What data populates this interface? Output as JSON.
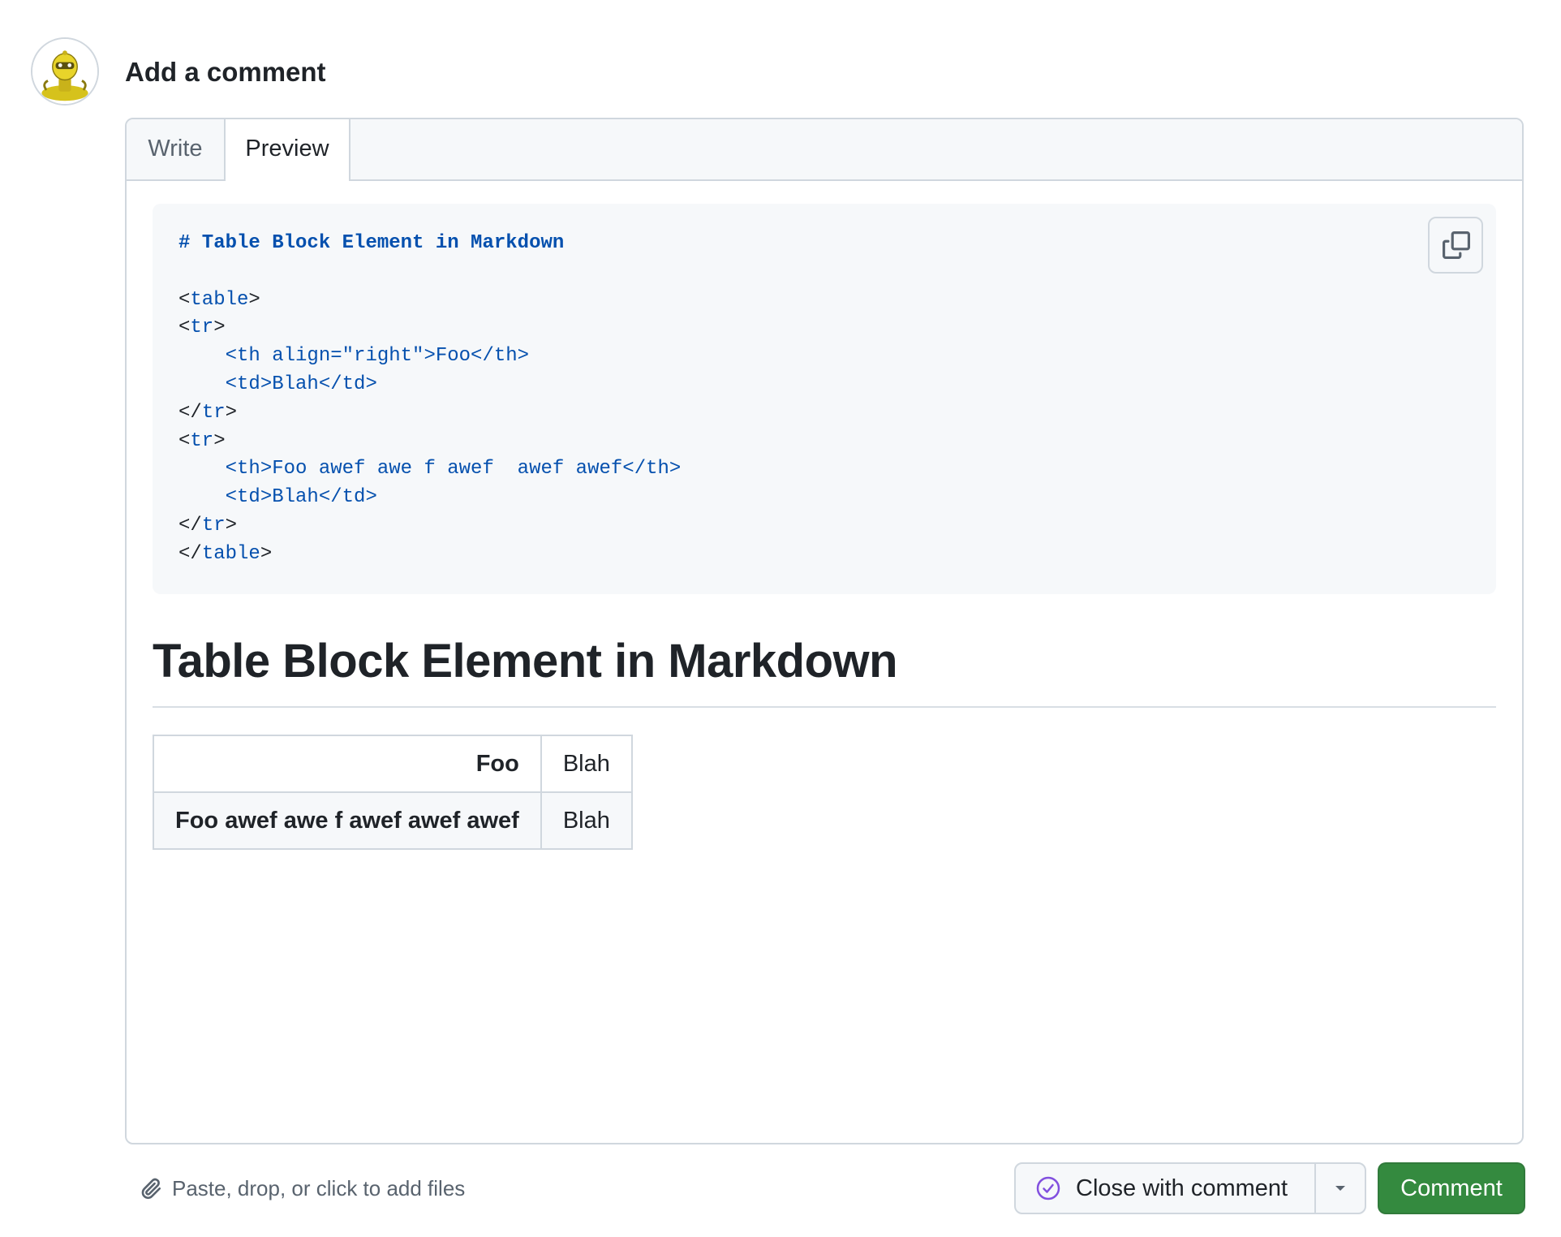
{
  "header": {
    "title": "Add a comment"
  },
  "avatar": {
    "icon": "robot-avatar-icon"
  },
  "tabs": [
    {
      "label": "Write",
      "active": false
    },
    {
      "label": "Preview",
      "active": true
    }
  ],
  "code_block": {
    "lines": [
      "# Table Block Element in Markdown",
      "",
      "<table>",
      "<tr>",
      "    <th align=\"right\">Foo</th>",
      "    <td>Blah</td>",
      "</tr>",
      "<tr>",
      "    <th>Foo awef awe f awef  awef awef</th>",
      "    <td>Blah</td>",
      "</tr>",
      "</table>"
    ],
    "copy_icon": "copy-icon"
  },
  "preview": {
    "heading": "Table Block Element in Markdown",
    "table": {
      "rows": [
        {
          "header": "Foo",
          "cell": "Blah"
        },
        {
          "header": "Foo awef awe f awef awef awef",
          "cell": "Blah"
        }
      ]
    }
  },
  "footer": {
    "attach_text": "Paste, drop, or click to add files",
    "attach_icon": "paperclip-icon",
    "close_button_label": "Close with comment",
    "close_icon": "check-circle-icon",
    "dropdown_icon": "triangle-down-icon",
    "comment_button_label": "Comment"
  },
  "colors": {
    "accent_blue": "#0550ae",
    "comment_green": "#348a3f",
    "close_purple": "#8250df",
    "border": "#d0d7de",
    "muted_bg": "#f6f8fa"
  }
}
